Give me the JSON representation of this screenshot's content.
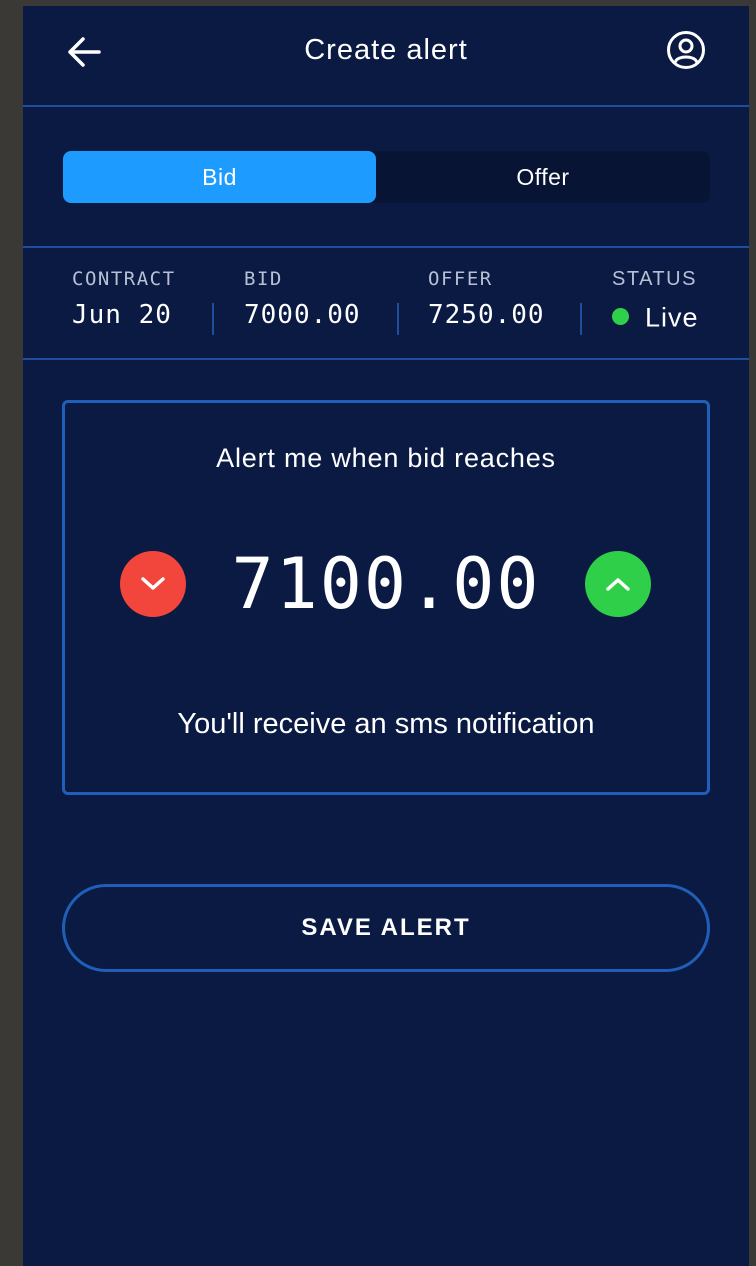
{
  "header": {
    "title": "Create alert",
    "back_icon": "arrow-left-icon",
    "account_icon": "user-circle-icon"
  },
  "toggle": {
    "options": [
      {
        "label": "Bid",
        "selected": true
      },
      {
        "label": "Offer",
        "selected": false
      }
    ]
  },
  "info": {
    "contract": {
      "label": "CONTRACT",
      "value": "Jun 20"
    },
    "bid": {
      "label": "BID",
      "value": "7000.00"
    },
    "offer": {
      "label": "OFFER",
      "value": "7250.00"
    },
    "status": {
      "label": "STATUS",
      "value": "Live",
      "color": "#2fd04a"
    }
  },
  "alert": {
    "prompt": "Alert me when bid reaches",
    "value": "7100.00",
    "decrease_icon": "chevron-down-icon",
    "increase_icon": "chevron-up-icon",
    "decrease_color": "#f2453b",
    "increase_color": "#2fcf49",
    "note": "You'll receive an sms notification"
  },
  "actions": {
    "save_label": "SAVE ALERT"
  },
  "colors": {
    "background": "#0b1a42",
    "accent": "#1e9bff",
    "border": "#1f5fb8"
  }
}
